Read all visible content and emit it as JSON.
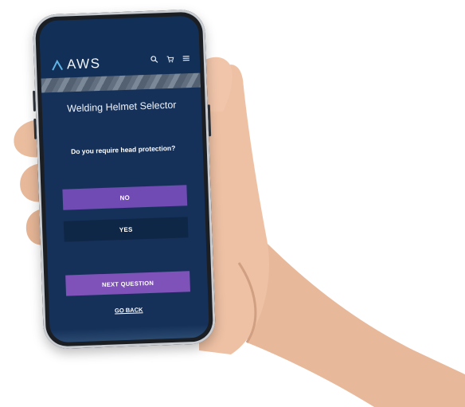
{
  "app": {
    "logo_text": "AWS"
  },
  "header": {
    "icons": [
      "search-icon",
      "cart-icon",
      "menu-icon"
    ]
  },
  "main": {
    "title": "Welding Helmet Selector",
    "question": "Do you require head protection?",
    "options": [
      {
        "label": "NO",
        "selected": true
      },
      {
        "label": "YES",
        "selected": false
      }
    ],
    "next_label": "NEXT QUESTION",
    "back_label": "GO BACK"
  },
  "colors": {
    "screen_bg": "#15315a",
    "selected_option": "#6f4bb3",
    "unselected_option": "#0f2746",
    "next_button": "#7e52b9"
  }
}
